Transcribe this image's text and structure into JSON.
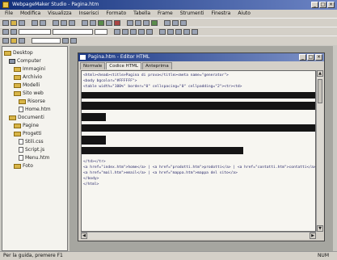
{
  "app": {
    "title": "WebpageMaker Studio - Pagina.htm"
  },
  "menu": [
    "File",
    "Modifica",
    "Visualizza",
    "Inserisci",
    "Formato",
    "Tabella",
    "Frame",
    "Strumenti",
    "Finestra",
    "Aiuto"
  ],
  "tree": {
    "items": [
      {
        "label": "Desktop",
        "type": "folder"
      },
      {
        "label": "Computer",
        "type": "computer"
      },
      {
        "label": "Immagini",
        "type": "folder"
      },
      {
        "label": "Archivio",
        "type": "folder"
      },
      {
        "label": "Modelli",
        "type": "folder"
      },
      {
        "label": "Sito web",
        "type": "folder"
      },
      {
        "label": "Risorse",
        "type": "folder"
      },
      {
        "label": "Home.htm",
        "type": "file"
      },
      {
        "label": "Documenti",
        "type": "folder"
      },
      {
        "label": "Pagine",
        "type": "folder"
      },
      {
        "label": "Progetti",
        "type": "folder"
      },
      {
        "label": "Stili.css",
        "type": "file"
      },
      {
        "label": "Script.js",
        "type": "file"
      },
      {
        "label": "Menu.htm",
        "type": "file"
      },
      {
        "label": "Foto",
        "type": "folder"
      }
    ]
  },
  "editor": {
    "title": "Pagina.htm - Editor HTML",
    "tabs": [
      "Normale",
      "Codice HTML",
      "Anteprima"
    ],
    "active_tab": 1,
    "lines_top": [
      "<html><head><title>Pagina di prova</title><meta name=\"generator\">",
      "<body bgcolor=\"#FFFFFF\">",
      "<table width=\"100%\" border=\"0\" cellspacing=\"0\" cellpadding=\"2\"><tr><td>"
    ],
    "lines_bottom": [
      "</td></tr>",
      "<a href=\"index.htm\">home</a> | <a href=\"prodotti.htm\">prodotti</a> | <a href=\"contatti.htm\">contatti</a>",
      "<a href=\"mail.htm\">email</a> | <a href=\"mappa.htm\">mappa del sito</a>",
      "</body>",
      "</html>"
    ]
  },
  "status": {
    "left": "Per la guida, premere F1",
    "right": "NUM"
  }
}
